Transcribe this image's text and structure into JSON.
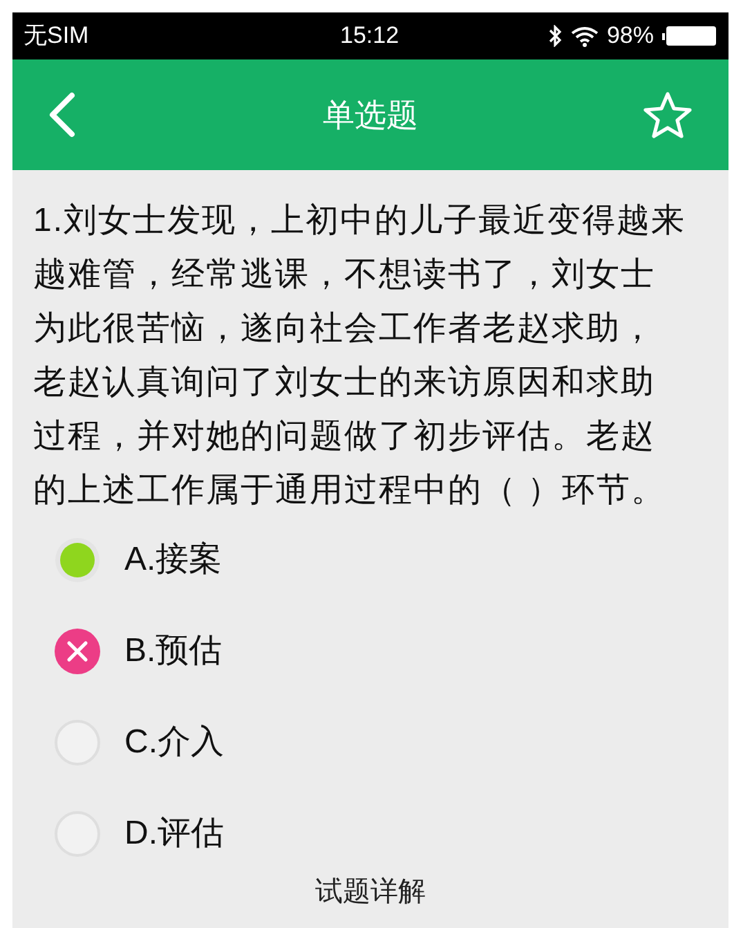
{
  "status_bar": {
    "carrier": "无SIM",
    "time": "15:12",
    "battery": "98%"
  },
  "nav_bar": {
    "title": "单选题",
    "favorited": false
  },
  "question": {
    "text": "1.刘女士发现，上初中的儿子最近变得越来越难管，经常逃课，不想读书了，刘女士为此很苦恼，遂向社会工作者老赵求助，老赵认真询问了刘女士的来访原因和求助过程，并对她的问题做了初步评估。老赵的上述工作属于通用过程中的（ ）环节。"
  },
  "options": [
    {
      "label": "A.接案",
      "selected": false,
      "correct": true
    },
    {
      "label": "B.预估",
      "selected": true,
      "correct": false
    },
    {
      "label": "C.介入",
      "selected": false,
      "correct": false
    },
    {
      "label": "D.评估",
      "selected": false,
      "correct": false
    }
  ],
  "explanation_link": "试题详解"
}
